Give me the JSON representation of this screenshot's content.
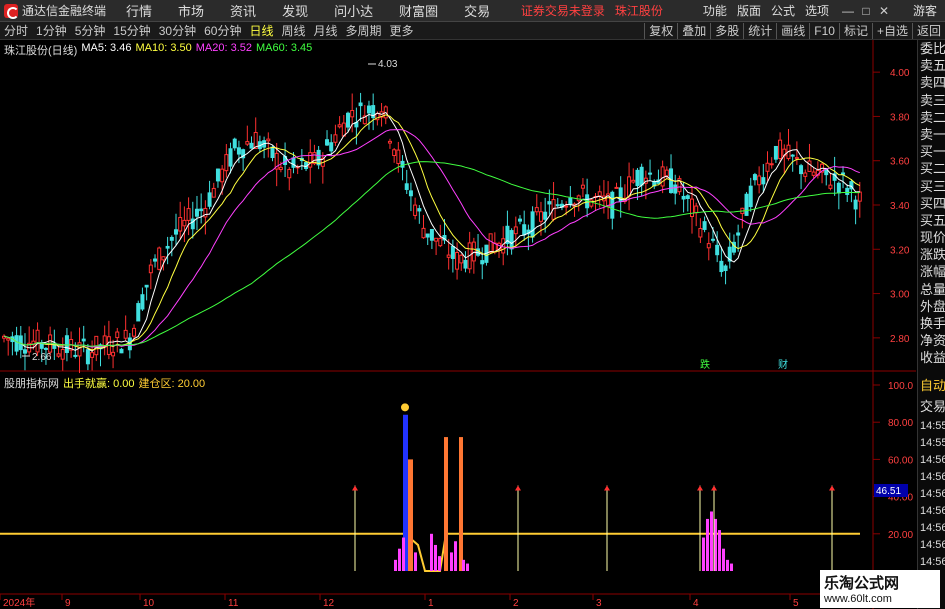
{
  "titlebar": {
    "app_title": "通达信金融终端",
    "menus": [
      "行情",
      "市场",
      "资讯",
      "发现",
      "问小达",
      "财富圈",
      "交易"
    ],
    "login_warning": "证券交易未登录",
    "stock_name": "珠江股份",
    "right_menus": [
      "功能",
      "版面",
      "公式",
      "选项"
    ],
    "window_buttons": [
      "—",
      "□",
      "✕"
    ],
    "guest": "游客"
  },
  "toolbar": {
    "periods": [
      "分时",
      "1分钟",
      "5分钟",
      "15分钟",
      "30分钟",
      "60分钟",
      "日线",
      "周线",
      "月线",
      "多周期",
      "更多"
    ],
    "active_period": "日线",
    "buttons": [
      "复权",
      "叠加",
      "多股",
      "统计",
      "画线",
      "F10",
      "标记",
      "+自选",
      "返回"
    ]
  },
  "stock_header": {
    "name": "珠江股份(日线)",
    "ma5": "MA5: 3.46",
    "ma10": "MA10: 3.50",
    "ma20": "MA20: 3.52",
    "ma60": "MA60: 3.45"
  },
  "indicator_header": {
    "name": "股朋指标网",
    "signal1": "出手就赢: 0.00",
    "signal2": "建仓区: 20.00"
  },
  "annotations": {
    "high": "4.03",
    "low": "2.66",
    "event1": "跌",
    "event2": "财",
    "current_value": "46.51"
  },
  "colors": {
    "up": "#ff3030",
    "down": "#40e0e0",
    "ma5": "#ffffff",
    "ma10": "#ffff40",
    "ma20": "#ff40ff",
    "ma60": "#40ff40"
  },
  "side_panel": {
    "items": [
      "委比",
      "卖五",
      "卖四",
      "卖三",
      "卖二",
      "卖一",
      "买一",
      "买二",
      "买三",
      "买四",
      "买五",
      "现价",
      "涨跌",
      "涨幅",
      "总量",
      "外盘",
      "换手",
      "净资",
      "收益"
    ],
    "lower_items": [
      "自动",
      "交易"
    ],
    "times": [
      "14:55",
      "14:55",
      "14:56",
      "14:56",
      "14:56",
      "14:56",
      "14:56",
      "14:56",
      "14:56"
    ]
  },
  "chart_data": {
    "type": "candlestick",
    "y_axis": [
      "4.00",
      "3.80",
      "3.60",
      "3.40",
      "3.20",
      "3.00",
      "2.80"
    ],
    "ylim": [
      2.7,
      4.1
    ],
    "indicator_axis": [
      "100.0",
      "80.00",
      "60.00",
      "40.00",
      "20.00"
    ],
    "indicator_ylim": [
      0,
      100
    ],
    "x_labels": [
      "2024年",
      "9",
      "10",
      "11",
      "12",
      "1",
      "2",
      "3",
      "4",
      "5"
    ]
  },
  "watermark": {
    "title": "乐淘公式网",
    "url": "www.60lt.com"
  }
}
